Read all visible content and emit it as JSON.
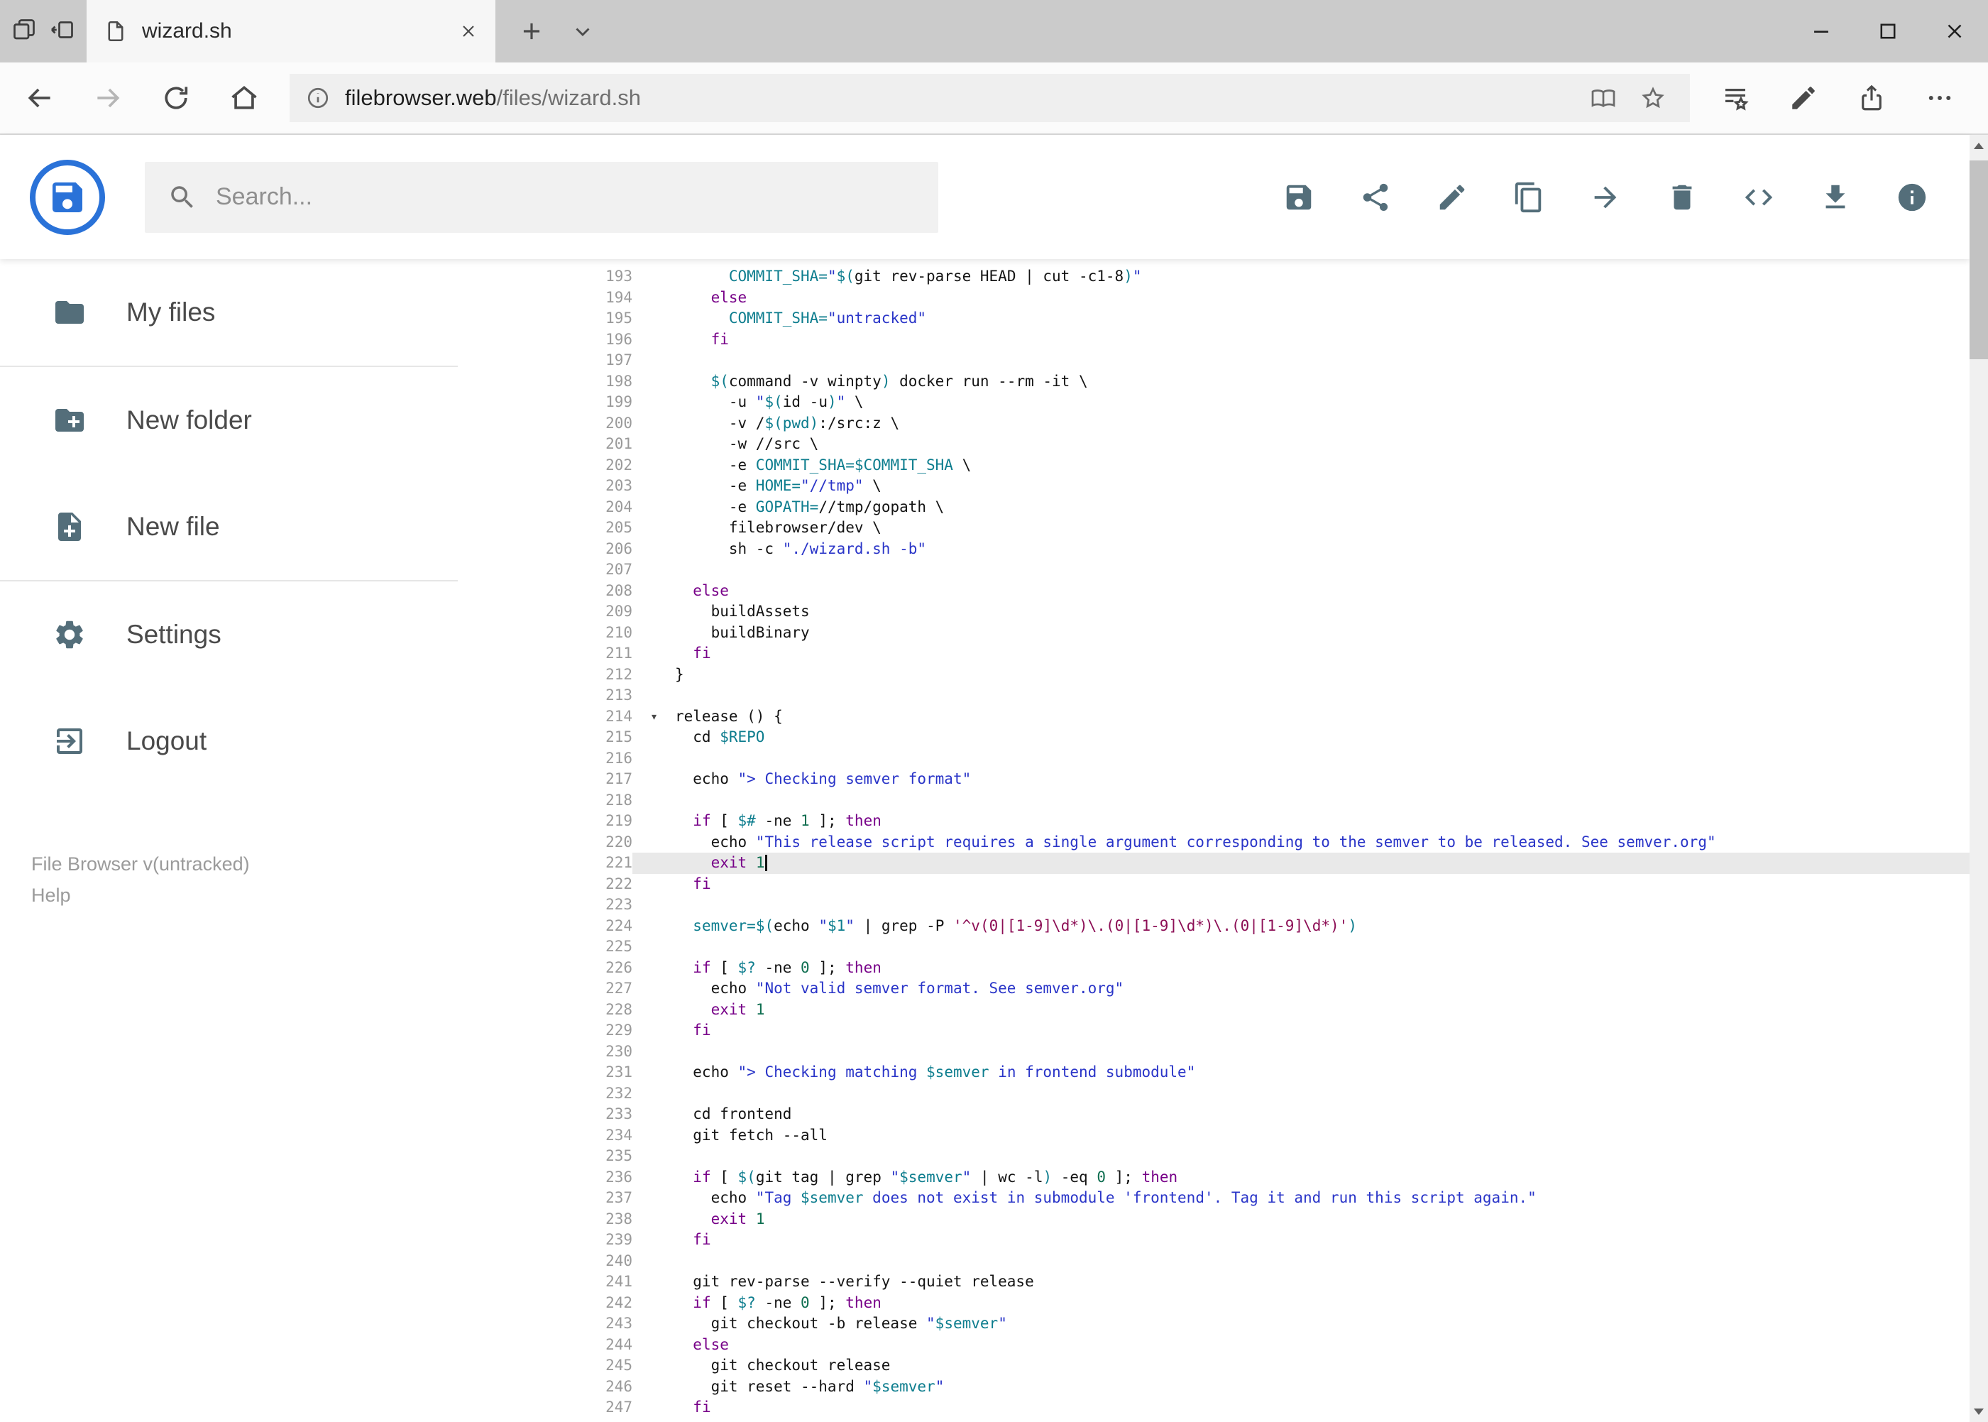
{
  "browser": {
    "tabbar_left_icons": [
      "tab-list",
      "set-aside"
    ],
    "tab": {
      "icon": "page",
      "title": "wizard.sh",
      "close_icon": "close"
    },
    "new_tab_icon": "plus",
    "tab_menu_icon": "chevron-down",
    "window_controls": [
      "minimize",
      "maximize",
      "close"
    ],
    "nav_icons": [
      {
        "name": "back",
        "enabled": true
      },
      {
        "name": "forward",
        "enabled": false
      },
      {
        "name": "refresh",
        "enabled": true
      },
      {
        "name": "home",
        "enabled": true
      }
    ],
    "address": {
      "icon": "site-info",
      "host": "filebrowser.web",
      "path": "/files/wizard.sh",
      "right_icons": [
        "reader",
        "star"
      ]
    },
    "toolbar_icons": [
      "hub",
      "pen",
      "share-page",
      "more"
    ]
  },
  "app": {
    "logo_icon": "floppy",
    "search": {
      "icon": "search",
      "placeholder": "Search..."
    },
    "header_actions": [
      "save",
      "share",
      "edit",
      "copy",
      "move",
      "delete",
      "code",
      "download",
      "info"
    ],
    "sidebar": {
      "items": [
        {
          "icon": "folder",
          "label": "My files",
          "divider_after": true
        },
        {
          "icon": "folder-plus",
          "label": "New folder",
          "divider_after": false
        },
        {
          "icon": "file-plus",
          "label": "New file",
          "divider_after": true
        },
        {
          "icon": "gear",
          "label": "Settings",
          "divider_after": false
        },
        {
          "icon": "logout",
          "label": "Logout",
          "divider_after": false
        }
      ],
      "footer_line1": "File Browser v(untracked)",
      "footer_line2": "Help"
    }
  },
  "colors": {
    "accent_blue": "#2a72d8",
    "header_icon_gray": "#546e7a",
    "active_line_bg": "#e9e9e9",
    "syntax_keyword": "#770088",
    "syntax_variable": "#0d7d8e",
    "syntax_string": "#2a35c8",
    "syntax_number": "#0e6e50",
    "syntax_regex": "#8c0e55"
  },
  "editor": {
    "active_line": 221,
    "lines": [
      {
        "n": 193,
        "parts": [
          [
            "pl",
            "      "
          ],
          [
            "var",
            "COMMIT_SHA="
          ],
          [
            "str",
            "\""
          ],
          [
            "var",
            "$("
          ],
          [
            "pl",
            "git rev-parse HEAD | cut -c1-8"
          ],
          [
            "var",
            ")"
          ],
          [
            "str",
            "\""
          ]
        ]
      },
      {
        "n": 194,
        "parts": [
          [
            "pl",
            "    "
          ],
          [
            "kw",
            "else"
          ]
        ]
      },
      {
        "n": 195,
        "parts": [
          [
            "pl",
            "      "
          ],
          [
            "var",
            "COMMIT_SHA="
          ],
          [
            "str",
            "\"untracked\""
          ]
        ]
      },
      {
        "n": 196,
        "parts": [
          [
            "pl",
            "    "
          ],
          [
            "kw",
            "fi"
          ]
        ]
      },
      {
        "n": 197,
        "parts": []
      },
      {
        "n": 198,
        "parts": [
          [
            "pl",
            "    "
          ],
          [
            "var",
            "$("
          ],
          [
            "pl",
            "command -v winpty"
          ],
          [
            "var",
            ")"
          ],
          [
            "pl",
            " docker run --rm -it \\"
          ]
        ]
      },
      {
        "n": 199,
        "parts": [
          [
            "pl",
            "      -u "
          ],
          [
            "str",
            "\""
          ],
          [
            "var",
            "$("
          ],
          [
            "pl",
            "id -u"
          ],
          [
            "var",
            ")"
          ],
          [
            "str",
            "\""
          ],
          [
            "pl",
            " \\"
          ]
        ]
      },
      {
        "n": 200,
        "parts": [
          [
            "pl",
            "      -v /"
          ],
          [
            "var",
            "$(pwd)"
          ],
          [
            "pl",
            ":/src:z \\"
          ]
        ]
      },
      {
        "n": 201,
        "parts": [
          [
            "pl",
            "      -w //src \\"
          ]
        ]
      },
      {
        "n": 202,
        "parts": [
          [
            "pl",
            "      -e "
          ],
          [
            "var",
            "COMMIT_SHA=$COMMIT_SHA"
          ],
          [
            "pl",
            " \\"
          ]
        ]
      },
      {
        "n": 203,
        "parts": [
          [
            "pl",
            "      -e "
          ],
          [
            "var",
            "HOME="
          ],
          [
            "str",
            "\"//tmp\""
          ],
          [
            "pl",
            " \\"
          ]
        ]
      },
      {
        "n": 204,
        "parts": [
          [
            "pl",
            "      -e "
          ],
          [
            "var",
            "GOPATH="
          ],
          [
            "pl",
            "//tmp/gopath \\"
          ]
        ]
      },
      {
        "n": 205,
        "parts": [
          [
            "pl",
            "      filebrowser/dev \\"
          ]
        ]
      },
      {
        "n": 206,
        "parts": [
          [
            "pl",
            "      sh -c "
          ],
          [
            "str",
            "\"./wizard.sh -b\""
          ]
        ]
      },
      {
        "n": 207,
        "parts": []
      },
      {
        "n": 208,
        "parts": [
          [
            "pl",
            "  "
          ],
          [
            "kw",
            "else"
          ]
        ]
      },
      {
        "n": 209,
        "parts": [
          [
            "pl",
            "    buildAssets"
          ]
        ]
      },
      {
        "n": 210,
        "parts": [
          [
            "pl",
            "    buildBinary"
          ]
        ]
      },
      {
        "n": 211,
        "parts": [
          [
            "pl",
            "  "
          ],
          [
            "kw",
            "fi"
          ]
        ]
      },
      {
        "n": 212,
        "parts": [
          [
            "pl",
            "}"
          ]
        ]
      },
      {
        "n": 213,
        "parts": []
      },
      {
        "n": 214,
        "fold": true,
        "parts": [
          [
            "pl",
            "release () {"
          ]
        ]
      },
      {
        "n": 215,
        "parts": [
          [
            "pl",
            "  cd "
          ],
          [
            "var",
            "$REPO"
          ]
        ]
      },
      {
        "n": 216,
        "parts": []
      },
      {
        "n": 217,
        "parts": [
          [
            "pl",
            "  echo "
          ],
          [
            "str",
            "\"> Checking semver format\""
          ]
        ]
      },
      {
        "n": 218,
        "parts": []
      },
      {
        "n": 219,
        "parts": [
          [
            "pl",
            "  "
          ],
          [
            "kw",
            "if"
          ],
          [
            "pl",
            " [ "
          ],
          [
            "var",
            "$#"
          ],
          [
            "pl",
            " -ne "
          ],
          [
            "num",
            "1"
          ],
          [
            "pl",
            " ]; "
          ],
          [
            "kw",
            "then"
          ]
        ]
      },
      {
        "n": 220,
        "parts": [
          [
            "pl",
            "    echo "
          ],
          [
            "str",
            "\"This release script requires a single argument corresponding to the semver to be released. See semver.org\""
          ]
        ]
      },
      {
        "n": 221,
        "cursor": true,
        "parts": [
          [
            "pl",
            "    "
          ],
          [
            "kw",
            "exit"
          ],
          [
            "pl",
            " "
          ],
          [
            "num",
            "1"
          ]
        ]
      },
      {
        "n": 222,
        "parts": [
          [
            "pl",
            "  "
          ],
          [
            "kw",
            "fi"
          ]
        ]
      },
      {
        "n": 223,
        "parts": []
      },
      {
        "n": 224,
        "parts": [
          [
            "pl",
            "  "
          ],
          [
            "var",
            "semver="
          ],
          [
            "var",
            "$("
          ],
          [
            "pl",
            "echo "
          ],
          [
            "str",
            "\""
          ],
          [
            "var",
            "$1"
          ],
          [
            "str",
            "\""
          ],
          [
            "pl",
            " | grep -P "
          ],
          [
            "rgx",
            "'^v(0|[1-9]\\d*)\\.(0|[1-9]\\d*)\\.(0|[1-9]\\d*)'"
          ],
          [
            "var",
            ")"
          ]
        ]
      },
      {
        "n": 225,
        "parts": []
      },
      {
        "n": 226,
        "parts": [
          [
            "pl",
            "  "
          ],
          [
            "kw",
            "if"
          ],
          [
            "pl",
            " [ "
          ],
          [
            "var",
            "$?"
          ],
          [
            "pl",
            " -ne "
          ],
          [
            "num",
            "0"
          ],
          [
            "pl",
            " ]; "
          ],
          [
            "kw",
            "then"
          ]
        ]
      },
      {
        "n": 227,
        "parts": [
          [
            "pl",
            "    echo "
          ],
          [
            "str",
            "\"Not valid semver format. See semver.org\""
          ]
        ]
      },
      {
        "n": 228,
        "parts": [
          [
            "pl",
            "    "
          ],
          [
            "kw",
            "exit"
          ],
          [
            "pl",
            " "
          ],
          [
            "num",
            "1"
          ]
        ]
      },
      {
        "n": 229,
        "parts": [
          [
            "pl",
            "  "
          ],
          [
            "kw",
            "fi"
          ]
        ]
      },
      {
        "n": 230,
        "parts": []
      },
      {
        "n": 231,
        "parts": [
          [
            "pl",
            "  echo "
          ],
          [
            "str",
            "\"> Checking matching "
          ],
          [
            "var",
            "$semver"
          ],
          [
            "str",
            " in frontend submodule\""
          ]
        ]
      },
      {
        "n": 232,
        "parts": []
      },
      {
        "n": 233,
        "parts": [
          [
            "pl",
            "  cd frontend"
          ]
        ]
      },
      {
        "n": 234,
        "parts": [
          [
            "pl",
            "  git fetch --all"
          ]
        ]
      },
      {
        "n": 235,
        "parts": []
      },
      {
        "n": 236,
        "parts": [
          [
            "pl",
            "  "
          ],
          [
            "kw",
            "if"
          ],
          [
            "pl",
            " [ "
          ],
          [
            "var",
            "$("
          ],
          [
            "pl",
            "git tag | grep "
          ],
          [
            "str",
            "\""
          ],
          [
            "var",
            "$semver"
          ],
          [
            "str",
            "\""
          ],
          [
            "pl",
            " | wc -l"
          ],
          [
            "var",
            ")"
          ],
          [
            "pl",
            " -eq "
          ],
          [
            "num",
            "0"
          ],
          [
            "pl",
            " ]; "
          ],
          [
            "kw",
            "then"
          ]
        ]
      },
      {
        "n": 237,
        "parts": [
          [
            "pl",
            "    echo "
          ],
          [
            "str",
            "\"Tag "
          ],
          [
            "var",
            "$semver"
          ],
          [
            "str",
            " does not exist in submodule 'frontend'. Tag it and run this script again.\""
          ]
        ]
      },
      {
        "n": 238,
        "parts": [
          [
            "pl",
            "    "
          ],
          [
            "kw",
            "exit"
          ],
          [
            "pl",
            " "
          ],
          [
            "num",
            "1"
          ]
        ]
      },
      {
        "n": 239,
        "parts": [
          [
            "pl",
            "  "
          ],
          [
            "kw",
            "fi"
          ]
        ]
      },
      {
        "n": 240,
        "parts": []
      },
      {
        "n": 241,
        "parts": [
          [
            "pl",
            "  git rev-parse --verify --quiet release"
          ]
        ]
      },
      {
        "n": 242,
        "parts": [
          [
            "pl",
            "  "
          ],
          [
            "kw",
            "if"
          ],
          [
            "pl",
            " [ "
          ],
          [
            "var",
            "$?"
          ],
          [
            "pl",
            " -ne "
          ],
          [
            "num",
            "0"
          ],
          [
            "pl",
            " ]; "
          ],
          [
            "kw",
            "then"
          ]
        ]
      },
      {
        "n": 243,
        "parts": [
          [
            "pl",
            "    git checkout -b release "
          ],
          [
            "str",
            "\""
          ],
          [
            "var",
            "$semver"
          ],
          [
            "str",
            "\""
          ]
        ]
      },
      {
        "n": 244,
        "parts": [
          [
            "pl",
            "  "
          ],
          [
            "kw",
            "else"
          ]
        ]
      },
      {
        "n": 245,
        "parts": [
          [
            "pl",
            "    git checkout release"
          ]
        ]
      },
      {
        "n": 246,
        "parts": [
          [
            "pl",
            "    git reset --hard "
          ],
          [
            "str",
            "\""
          ],
          [
            "var",
            "$semver"
          ],
          [
            "str",
            "\""
          ]
        ]
      },
      {
        "n": 247,
        "parts": [
          [
            "pl",
            "  "
          ],
          [
            "kw",
            "fi"
          ]
        ]
      }
    ]
  }
}
